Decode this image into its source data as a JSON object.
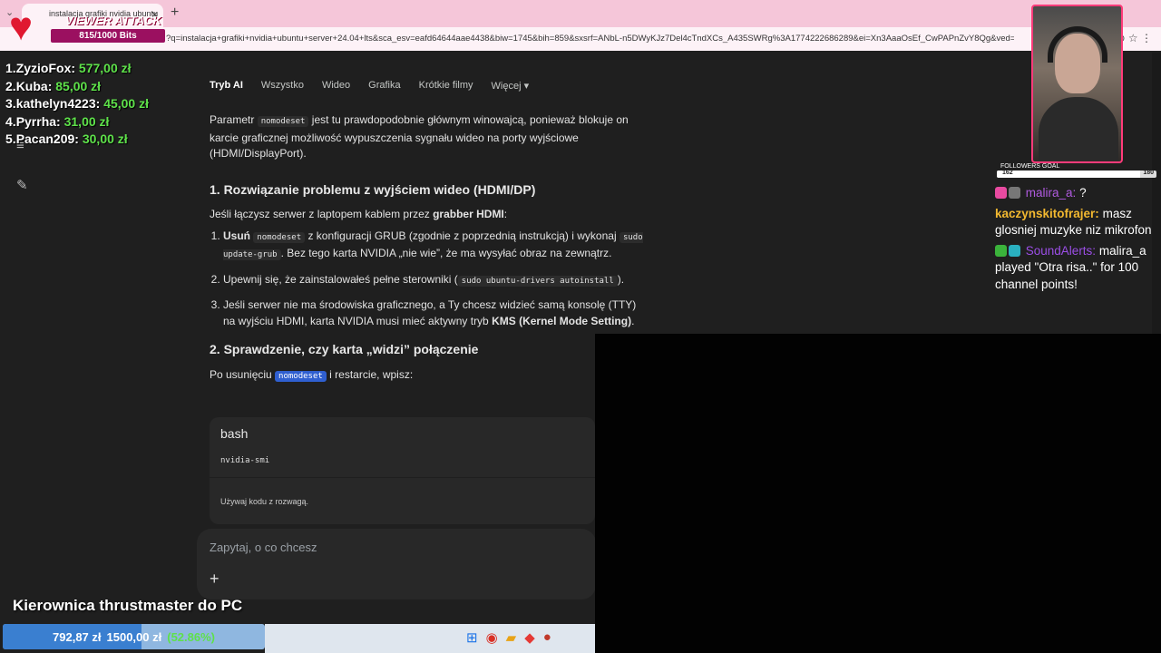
{
  "browser": {
    "tab_title": "instalacja grafiki nvidia ubuntu",
    "tab_close": "×",
    "new_tab": "+",
    "url": "?q=instalacja+grafiki+nvidia+ubuntu+server+24.04+lts&sca_esv=eafd64644aae4438&biw=1745&bih=859&sxsrf=ANbL-n5DWyKJz7Del4cTndXCs_A435SWRg%3A1774222686289&ei=Xn3AaaOsEf_CwPAPnZvY8Qg&ved=2ah..."
  },
  "search_tabs": [
    {
      "label": "Tryb AI"
    },
    {
      "label": "Wszystko"
    },
    {
      "label": "Wideo"
    },
    {
      "label": "Grafika"
    },
    {
      "label": "Krótkie filmy"
    },
    {
      "label": "Więcej ▾"
    }
  ],
  "article": {
    "intro_pre": "Parametr ",
    "intro_code": "nomodeset",
    "intro_post": " jest tu prawdopodobnie głównym winowajcą, ponieważ blokuje on karcie graficznej możliwość wypuszczenia sygnału wideo na porty wyjściowe (HDMI/DisplayPort).",
    "h1": "1. Rozwiązanie problemu z wyjściem wideo (HDMI/DP)",
    "p1_pre": "Jeśli łączysz serwer z laptopem kablem przez ",
    "p1_bold": "grabber HDMI",
    "p1_post": ":",
    "li1_bold": "Usuń",
    "li1_code1": "nomodeset",
    "li1_mid": " z konfiguracji GRUB (zgodnie z poprzednią instrukcją) i wykonaj ",
    "li1_code2": "sudo update-grub",
    "li1_post": ". Bez tego karta NVIDIA „nie wie”, że ma wysyłać obraz na zewnątrz.",
    "li2_pre": "Upewnij się, że zainstalowałeś pełne sterowniki (",
    "li2_code": "sudo ubuntu-drivers autoinstall",
    "li2_post": ").",
    "li3_pre": "Jeśli serwer nie ma środowiska graficznego, a Ty chcesz widzieć samą konsolę (TTY) na wyjściu HDMI, karta NVIDIA musi mieć aktywny tryb ",
    "li3_bold": "KMS (Kernel Mode Setting)",
    "li3_post": ".",
    "h2": "2. Sprawdzenie, czy karta „widzi” połączenie",
    "p2_pre": "Po usunięciu ",
    "p2_code": "nomodeset",
    "p2_post": " i restarcie, wpisz:"
  },
  "codeblock": {
    "lang": "bash",
    "code": "nvidia-smi",
    "note": "Używaj kodu z rozwagą."
  },
  "ask": {
    "placeholder": "Zapytaj, o co chcesz",
    "plus": "+"
  },
  "viewer_attack": {
    "title": "VIEWER ATTACK",
    "bits": "815/1000 Bits",
    "progress": 0.815
  },
  "donors": [
    {
      "rank": "1.",
      "name": "ZyzioFox:",
      "amount": "577,00 zł"
    },
    {
      "rank": "2.",
      "name": "Kuba:",
      "amount": "85,00 zł"
    },
    {
      "rank": "3.",
      "name": "kathelyn4223:",
      "amount": "45,00 zł"
    },
    {
      "rank": "4.",
      "name": "Pyrrha:",
      "amount": "31,00 zł"
    },
    {
      "rank": "5.",
      "name": "Pacan209:",
      "amount": "30,00 zł"
    }
  ],
  "followers_goal": {
    "label": "FOLLOWERS GOAL",
    "current": "162",
    "target": "180",
    "progress": 0.9
  },
  "chat": [
    {
      "user": "malira_a:",
      "text": "?"
    },
    {
      "user": "kaczynskitofrajer:",
      "text": "masz glosniej muzyke niz mikrofon"
    },
    {
      "user": "SoundAlerts:",
      "text": "malira_a played \"Otra risa..\" for 100 channel points!"
    }
  ],
  "promo": {
    "title": "Kierownica thrustmaster do PC",
    "current": "792,87 zł",
    "target": "1500,00 zł",
    "percent": "(52.86%)",
    "progress": 0.5286
  },
  "colors": {
    "accent_pink": "#ff3b7a",
    "donation_green": "#5ee14a",
    "selection_blue": "#2f5fd0"
  }
}
